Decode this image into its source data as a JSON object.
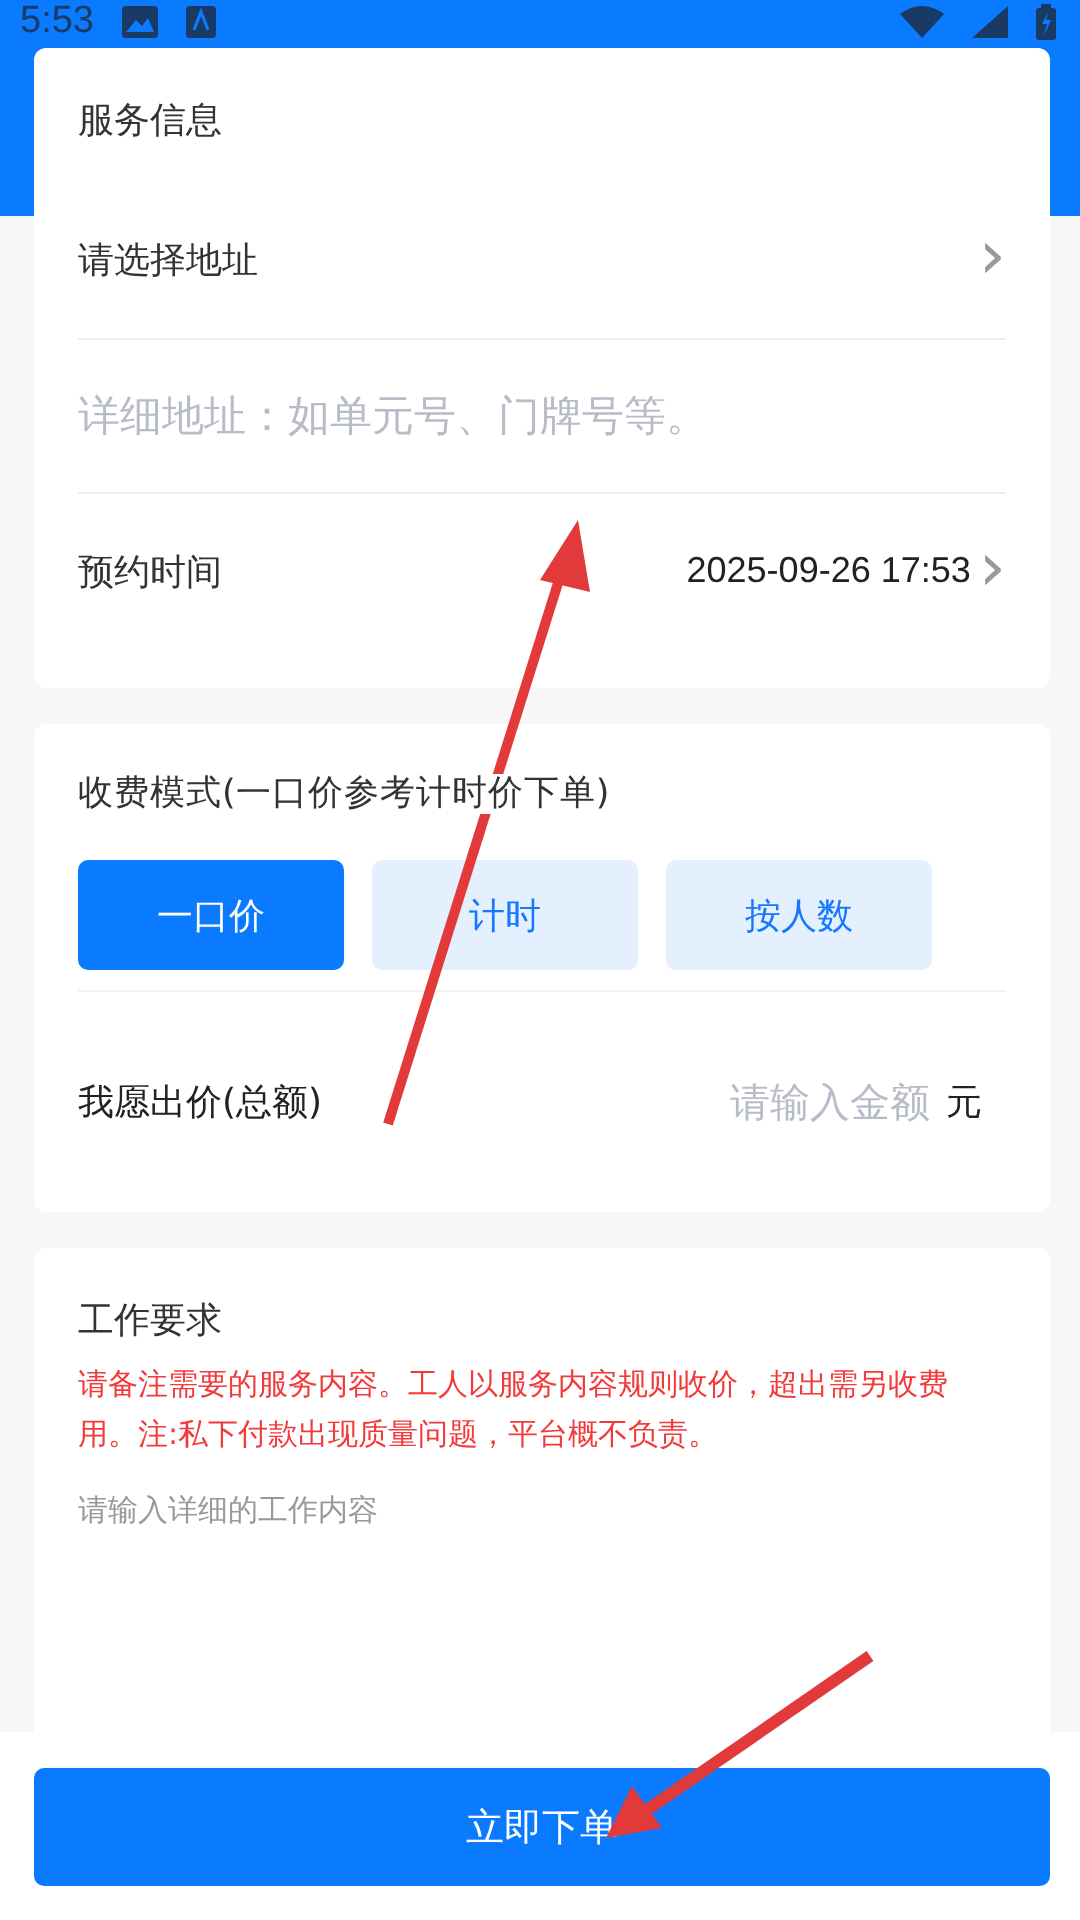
{
  "status_bar": {
    "time": "5:53"
  },
  "service_info": {
    "title": "服务信息",
    "address": {
      "label": "请选择地址",
      "chevron": "›"
    },
    "detail": {
      "placeholder": "详细地址：如单元号、门牌号等。"
    },
    "appointment": {
      "label": "预约时间",
      "value": "2025-09-26 17:53",
      "chevron": "›"
    }
  },
  "pricing": {
    "title": "收费模式(一口价参考计时价下单)",
    "modes": [
      {
        "label": "一口价",
        "selected": true
      },
      {
        "label": "计时",
        "selected": false
      },
      {
        "label": "按人数",
        "selected": false
      }
    ],
    "offer": {
      "label": "我愿出价(总额)",
      "placeholder": "请输入金额",
      "unit": "元"
    }
  },
  "work": {
    "title": "工作要求",
    "notice": "请备注需要的服务内容。工人以服务内容规则收价，超出需另收费用。注:私下付款出现质量问题，平台概不负责。",
    "placeholder": "请输入详细的工作内容"
  },
  "submit": {
    "label": "立即下单"
  }
}
